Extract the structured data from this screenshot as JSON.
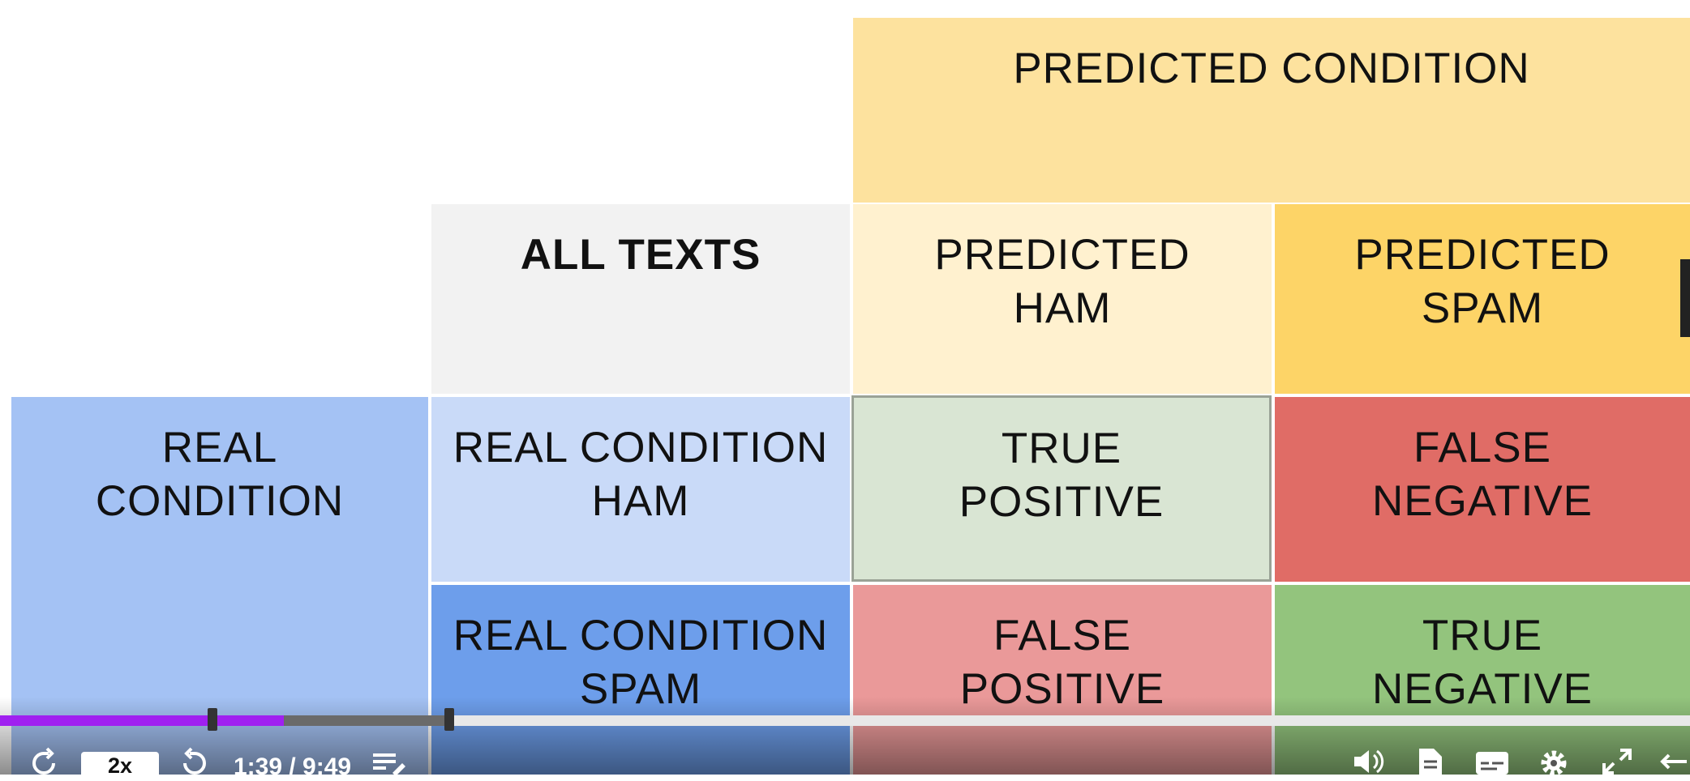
{
  "matrix": {
    "predicted_condition": "PREDICTED CONDITION",
    "all_texts": "ALL TEXTS",
    "predicted_ham": "PREDICTED\nHAM",
    "predicted_spam": "PREDICTED\nSPAM",
    "real_condition": "REAL\nCONDITION",
    "real_condition_ham": "REAL CONDITION\nHAM",
    "real_condition_spam": "REAL CONDITION\nSPAM",
    "true_positive": "TRUE\nPOSITIVE",
    "false_negative": "FALSE\nNEGATIVE",
    "false_positive": "FALSE\nPOSITIVE",
    "true_negative": "TRUE\nNEGATIVE"
  },
  "player": {
    "speed": "2x",
    "time": "1:39 / 9:49",
    "progress_fraction": 0.168,
    "icons": [
      "rewind-icon",
      "forward-icon",
      "transcript-icon",
      "volume-icon",
      "notes-icon",
      "captions-icon",
      "gear-icon",
      "fullscreen-icon",
      "expand-icon"
    ]
  },
  "colors": {
    "accent": "#a020f0"
  }
}
